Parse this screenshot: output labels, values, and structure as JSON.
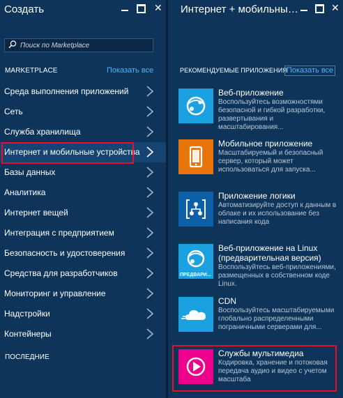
{
  "left": {
    "title": "Создать",
    "search": {
      "placeholder": "Поиск по Marketplace",
      "value": ""
    },
    "section_label": "MARKETPLACE",
    "show_all": "Показать все",
    "categories": [
      "Среда выполнения приложений",
      "Сеть",
      "Служба хранилища",
      "Интернет и мобильные устройства",
      "Базы данных",
      "Аналитика",
      "Интернет вещей",
      "Интеграция с предприятием",
      "Безопасность и удостоверения",
      "Средства для разработчиков",
      "Мониторинг и управление",
      "Надстройки",
      "Контейнеры"
    ],
    "active_index": 3,
    "recent_label": "ПОСЛЕДНИЕ"
  },
  "right": {
    "title": "Интернет + мобильные...",
    "section_label": "РЕКОМЕНДУЕМЫЕ ПРИЛОЖЕНИЯ",
    "show_all": "Показать все",
    "apps": [
      {
        "name": "Веб-приложение",
        "desc": "Воспользуйтесь возможностями безопасной и гибкой разработки, развертывания и масштабирования...",
        "icon": "web-app-icon",
        "color": "#1ba1e2"
      },
      {
        "name": "Мобильное приложение",
        "desc": "Масштабируемый и безопасный сервер, который может использоваться для запуска...",
        "icon": "mobile-app-icon",
        "color": "#e8750c"
      },
      {
        "name": "Приложение логики",
        "desc": "Автоматизируйте доступ к данным в облаке и их использование без написания кода",
        "icon": "logic-app-icon",
        "color": "#0d5fa8"
      },
      {
        "name": "Веб-приложение на Linux (предварительная версия)",
        "desc": "Воспользуйтесь веб-приложениями, размещенных в собственном коде Linux.",
        "icon": "web-app-linux-icon",
        "color": "#1ba1e2",
        "tile_label": "ПРЕДВАРИ..."
      },
      {
        "name": "CDN",
        "desc": "Воспользуйтесь масштабируемыми глобально распределенными пограничными серверами для...",
        "icon": "cdn-icon",
        "color": "#1ba1e2"
      },
      {
        "name": "Службы мультимедиа",
        "desc": "Кодировка, хранение и потоковая передача аудио и видео с учетом масштаба",
        "icon": "media-services-icon",
        "color": "#ec008c"
      }
    ],
    "highlight_index": 5
  }
}
